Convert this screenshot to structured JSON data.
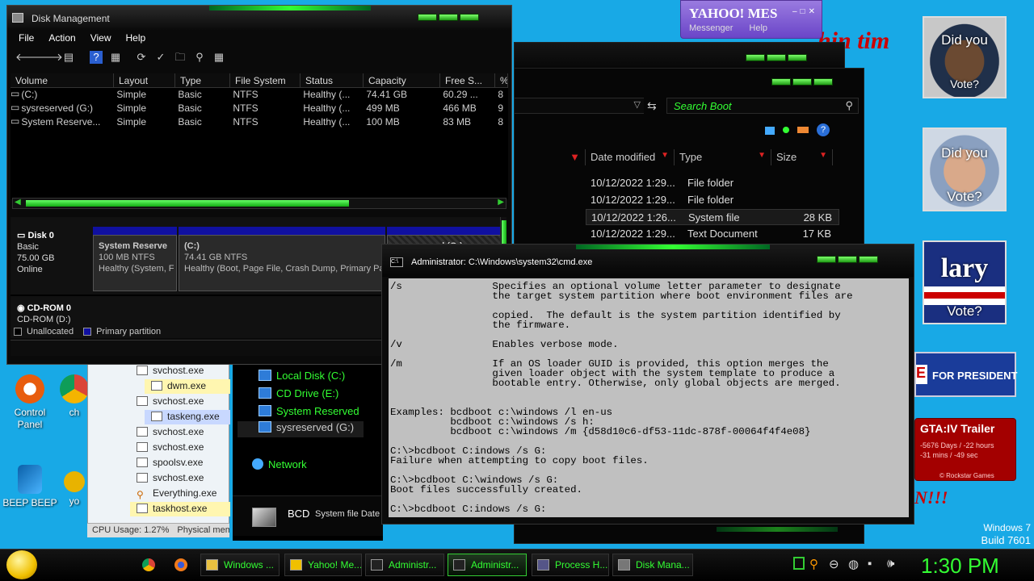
{
  "disk_management": {
    "title": "Disk Management",
    "menu": [
      "File",
      "Action",
      "View",
      "Help"
    ],
    "columns": [
      "Volume",
      "Layout",
      "Type",
      "File System",
      "Status",
      "Capacity",
      "Free S...",
      "%"
    ],
    "rows": [
      [
        "(C:)",
        "Simple",
        "Basic",
        "NTFS",
        "Healthy (...",
        "74.41 GB",
        "60.29 ...",
        "8"
      ],
      [
        "sysreserved (G:)",
        "Simple",
        "Basic",
        "NTFS",
        "Healthy (...",
        "499 MB",
        "466 MB",
        "9"
      ],
      [
        "System Reserve...",
        "Simple",
        "Basic",
        "NTFS",
        "Healthy (...",
        "100 MB",
        "83 MB",
        "8"
      ]
    ],
    "disk0": {
      "name": "Disk 0",
      "type": "Basic",
      "size": "75.00 GB",
      "status": "Online"
    },
    "partitions": [
      {
        "name": "System Reserve",
        "size": "100 MB NTFS",
        "status": "Healthy (System, F"
      },
      {
        "name": "(C:)",
        "size": "74.41 GB NTFS",
        "status": "Healthy (Boot, Page File, Crash Dump, Primary Par"
      },
      {
        "name": "sysreserved (G:)",
        "size": "",
        "status": ""
      }
    ],
    "cdrom": {
      "name": "CD-ROM 0",
      "sub": "CD-ROM (D:)"
    },
    "legend": {
      "unallocated": "Unallocated",
      "primary": "Primary partition"
    }
  },
  "explorer": {
    "search_placeholder": "Search Boot",
    "columns": [
      "Date modified",
      "Type",
      "Size"
    ],
    "files": [
      {
        "date": "10/12/2022 1:29...",
        "type": "File folder",
        "size": ""
      },
      {
        "date": "10/12/2022 1:29...",
        "type": "File folder",
        "size": ""
      },
      {
        "date": "10/12/2022 1:26...",
        "type": "System file",
        "size": "28 KB"
      },
      {
        "date": "10/12/2022 1:29...",
        "type": "Text Document",
        "size": "17 KB"
      }
    ],
    "nav": [
      "Local Disk (C:)",
      "CD Drive (E:)",
      "System Reserved",
      "sysreserved (G:)"
    ],
    "network": "Network",
    "details_name": "BCD",
    "details_sub": "System file  Date"
  },
  "process_tree": {
    "items": [
      {
        "name": "svchost.exe",
        "indent": 0,
        "hl": "none"
      },
      {
        "name": "dwm.exe",
        "indent": 1,
        "hl": "yellow"
      },
      {
        "name": "svchost.exe",
        "indent": 0,
        "hl": "none"
      },
      {
        "name": "taskeng.exe",
        "indent": 1,
        "hl": "blue"
      },
      {
        "name": "svchost.exe",
        "indent": 0,
        "hl": "none"
      },
      {
        "name": "svchost.exe",
        "indent": 0,
        "hl": "none"
      },
      {
        "name": "spoolsv.exe",
        "indent": 0,
        "hl": "none"
      },
      {
        "name": "svchost.exe",
        "indent": 0,
        "hl": "none"
      },
      {
        "name": "Everything.exe",
        "indent": 0,
        "hl": "none"
      },
      {
        "name": "taskhost.exe",
        "indent": 0,
        "hl": "yellow"
      }
    ],
    "cpu": "CPU Usage: 1.27%",
    "phys": "Physical mem"
  },
  "cmd": {
    "title": "Administrator: C:\\Windows\\system32\\cmd.exe",
    "text": "/s               Specifies an optional volume letter parameter to designate\n                 the target system partition where boot environment files are\n\n                 copied.  The default is the system partition identified by\n                 the firmware.\n\n/v               Enables verbose mode.\n\n/m               If an OS loader GUID is provided, this option merges the\n                 given loader object with the system template to produce a\n                 bootable entry. Otherwise, only global objects are merged.\n\n\nExamples: bcdboot c:\\windows /l en-us\n          bcdboot c:\\windows /s h:\n          bcdboot c:\\windows /m {d58d10c6-df53-11dc-878f-00064f4f4e08}\n\nC:\\>bcdboot C:indows /s G:\nFailure when attempting to copy boot files.\n\nC:\\>bcdboot C:\\windows /s G:\nBoot files successfully created.\n\nC:\\>bcdboot C:indows /s G:"
  },
  "yahoo": {
    "logo": "YAHOO! MES",
    "menu": [
      "Messenger",
      "Help"
    ]
  },
  "desktop": {
    "wallpaper_text": "hin  tim",
    "vote_cards": [
      {
        "top": "Did you",
        "bottom": "Vote?"
      },
      {
        "top": "Did you",
        "bottom": "Vote?"
      },
      {
        "top": "lary",
        "bottom": "Vote?"
      }
    ],
    "president": "FOR PRESIDENT",
    "gta": {
      "title": "GTA:IV Trailer",
      "line1": "-5676 Days / -22 hours",
      "line2": "-31 mins / -49 sec",
      "brand": "© Rockstar Games"
    },
    "bang": "N!!!",
    "icons": [
      "Control Panel",
      "BEEP BEEP",
      "ch",
      "yo"
    ],
    "watermark1": "Windows 7",
    "watermark2": "Build 7601"
  },
  "taskbar": {
    "buttons": [
      "Windows ...",
      "Yahoo! Me...",
      "Administr...",
      "Administr...",
      "Process H...",
      "Disk Mana..."
    ],
    "clock": "1:30 PM"
  },
  "colors": {
    "accent": "#33ff33",
    "desktop": "#18a9e6"
  }
}
